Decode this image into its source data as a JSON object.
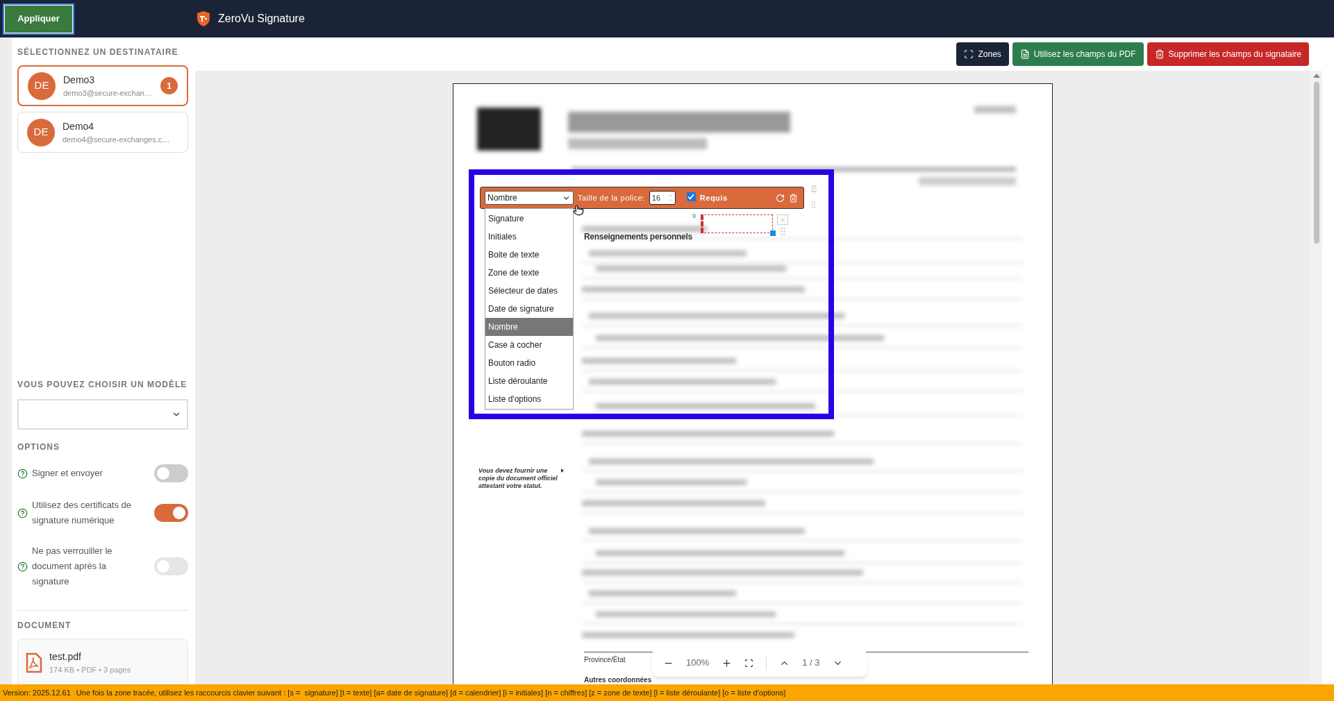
{
  "header": {
    "apply_button": "Appliquer",
    "title": "ZeroVu Signature"
  },
  "toolbar": {
    "buttons": [
      {
        "kind": "zones",
        "label": "Zones"
      },
      {
        "kind": "pdf",
        "label": "Utilisez les champs du PDF"
      },
      {
        "kind": "delete",
        "label": "Supprimer les champs du signataire"
      }
    ]
  },
  "sidebar": {
    "recipients_title": "SÉLECTIONNEZ UN DESTINATAIRE",
    "recipients": [
      {
        "initials": "DE",
        "name": "Demo3",
        "email": "demo3@secure-exchan…",
        "badge": "1",
        "selected": true
      },
      {
        "initials": "DE",
        "name": "Demo4",
        "email": "demo4@secure-exchanges.c…",
        "selected": false
      }
    ],
    "template_title": "VOUS POUVEZ CHOISIR UN MODÈLE",
    "options_title": "OPTIONS",
    "options": [
      {
        "label": "Signer et envoyer",
        "on": false,
        "disabled": false
      },
      {
        "label": "Utilisez des certificats de signature numérique",
        "on": true,
        "disabled": false
      },
      {
        "label": "Ne pas verrouiller le document après la signature",
        "on": false,
        "disabled": true
      }
    ],
    "document_title": "DOCUMENT",
    "file": {
      "name": "test.pdf",
      "meta": "174 KB • PDF • 3 pages"
    }
  },
  "pdf": {
    "section_heading": "Renseignements personnels",
    "note": "Vous devez fournir une copie du document officiel attestant votre statut.",
    "province_label": "Province/État",
    "other_heading": "Autres coordonnées",
    "field_toolbar": {
      "type_value": "Nombre",
      "font_size_label": "Taille de la police:",
      "font_size": "16",
      "required": {
        "label": "Requis",
        "checked": true
      }
    },
    "type_menu": [
      {
        "label": "Signature",
        "selected": false
      },
      {
        "label": "Initiales",
        "selected": false
      },
      {
        "label": "Boite de texte",
        "selected": false
      },
      {
        "label": "Zone de texte",
        "selected": false
      },
      {
        "label": "Sélecteur de dates",
        "selected": false
      },
      {
        "label": "Date de signature",
        "selected": false
      },
      {
        "label": "Nombre",
        "selected": true
      },
      {
        "label": "Case à cocher",
        "selected": false
      },
      {
        "label": "Bouton radio",
        "selected": false
      },
      {
        "label": "Liste déroulante",
        "selected": false
      },
      {
        "label": "Liste d'options",
        "selected": false
      }
    ],
    "field_order": "9",
    "zoom": {
      "level": "100%",
      "page": "1 / 3"
    }
  },
  "status_bar": {
    "version": "Version: 2025.12.61",
    "hint": "Une fois la zone tracée, utilisez les raccourcis clavier suivant : [s =  signature] [t = texte] [a= date de signature] [d = calendrier] [i = initiales] [n = chiffres] [z = zone de texte] [l = liste déroulante] [o = liste d'options]"
  }
}
